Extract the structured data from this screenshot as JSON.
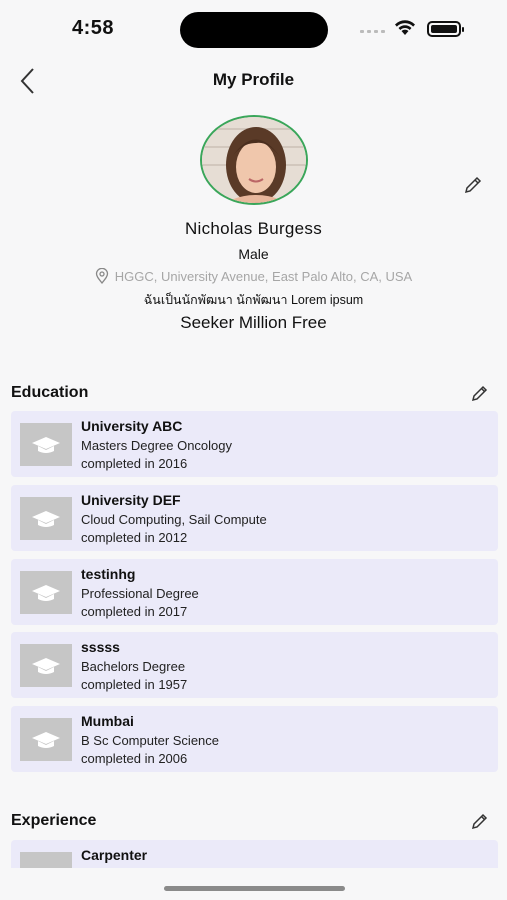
{
  "status_bar": {
    "time": "4:58"
  },
  "nav": {
    "title": "My Profile"
  },
  "profile": {
    "name": "Nicholas Burgess",
    "gender": "Male",
    "location": "HGGC, University Avenue, East Palo Alto, CA, USA",
    "bio": "ฉันเป็นนักพัฒนา นักพัฒนา Lorem ipsum",
    "plan": "Seeker Million Free"
  },
  "education": {
    "title": "Education",
    "items": [
      {
        "school": "University ABC",
        "degree": "Masters Degree Oncology",
        "completed": "completed in 2016"
      },
      {
        "school": "University DEF",
        "degree": "Cloud Computing, Sail Compute",
        "completed": "completed in 2012"
      },
      {
        "school": "testinhg",
        "degree": "Professional Degree",
        "completed": "completed in 2017"
      },
      {
        "school": "sssss",
        "degree": "Bachelors Degree",
        "completed": "completed in 1957"
      },
      {
        "school": "Mumbai",
        "degree": "B Sc Computer Science",
        "completed": "completed in 2006"
      }
    ]
  },
  "experience": {
    "title": "Experience",
    "items": [
      {
        "title": "Carpenter"
      }
    ]
  },
  "colors": {
    "card_bg": "#ebeaf9",
    "avatar_ring": "#3aa65a",
    "muted_text": "#a6a6a6"
  },
  "icons": [
    "back-chevron-icon",
    "pencil-icon",
    "location-pin-icon",
    "graduation-cap-icon",
    "wifi-icon",
    "battery-icon"
  ]
}
